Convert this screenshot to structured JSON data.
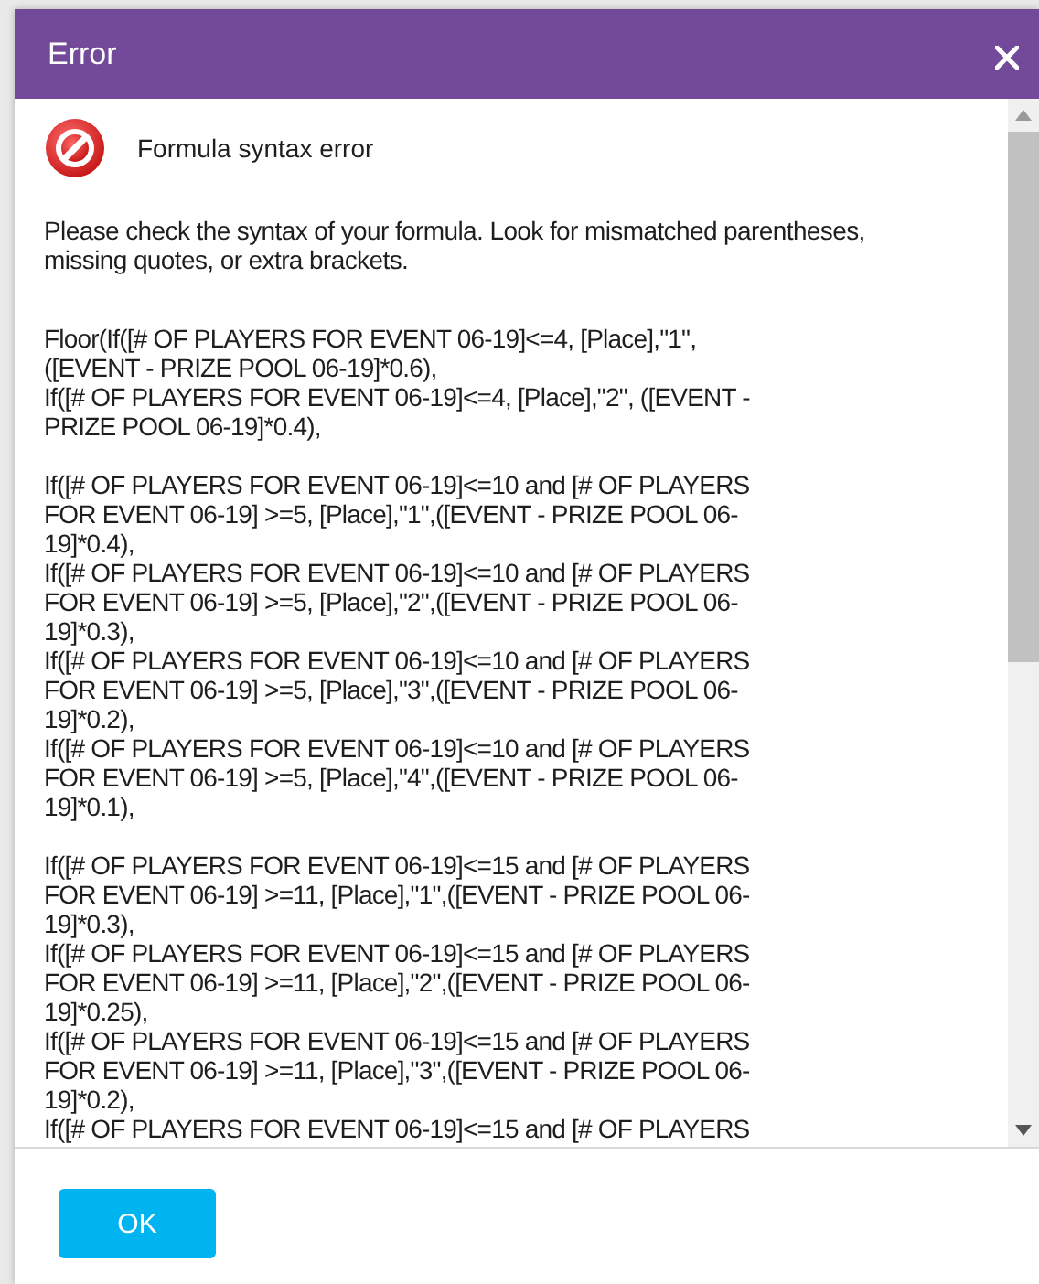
{
  "dialog": {
    "title": "Error"
  },
  "heading": "Formula syntax error",
  "message": "Please check the syntax of your formula. Look for mismatched parentheses, missing quotes, or extra brackets.",
  "formula_blocks": [
    [
      "Floor(If([# OF PLAYERS FOR EVENT 06-19]<=4, [Place],\"1\",",
      "([EVENT - PRIZE POOL 06-19]*0.6),",
      "If([# OF PLAYERS FOR EVENT 06-19]<=4, [Place],\"2\", ([EVENT -",
      "PRIZE POOL 06-19]*0.4),"
    ],
    [
      "If([# OF PLAYERS FOR EVENT 06-19]<=10 and [# OF PLAYERS",
      "FOR EVENT 06-19] >=5, [Place],\"1\",([EVENT - PRIZE POOL 06-",
      "19]*0.4),",
      "If([# OF PLAYERS FOR EVENT 06-19]<=10 and [# OF PLAYERS",
      "FOR EVENT 06-19] >=5, [Place],\"2\",([EVENT - PRIZE POOL 06-",
      "19]*0.3),",
      "If([# OF PLAYERS FOR EVENT 06-19]<=10 and [# OF PLAYERS",
      "FOR EVENT 06-19] >=5, [Place],\"3\",([EVENT - PRIZE POOL 06-",
      "19]*0.2),",
      "If([# OF PLAYERS FOR EVENT 06-19]<=10 and [# OF PLAYERS",
      "FOR EVENT 06-19] >=5, [Place],\"4\",([EVENT - PRIZE POOL 06-",
      "19]*0.1),"
    ],
    [
      "If([# OF PLAYERS FOR EVENT 06-19]<=15 and [# OF PLAYERS",
      "FOR EVENT 06-19] >=11, [Place],\"1\",([EVENT - PRIZE POOL 06-",
      "19]*0.3),",
      "If([# OF PLAYERS FOR EVENT 06-19]<=15 and [# OF PLAYERS",
      "FOR EVENT 06-19] >=11, [Place],\"2\",([EVENT - PRIZE POOL 06-",
      "19]*0.25),",
      "If([# OF PLAYERS FOR EVENT 06-19]<=15 and [# OF PLAYERS",
      "FOR EVENT 06-19] >=11, [Place],\"3\",([EVENT - PRIZE POOL 06-",
      "19]*0.2),",
      "If([# OF PLAYERS FOR EVENT 06-19]<=15 and [# OF PLAYERS"
    ]
  ],
  "buttons": [
    {
      "label": "OK"
    }
  ]
}
